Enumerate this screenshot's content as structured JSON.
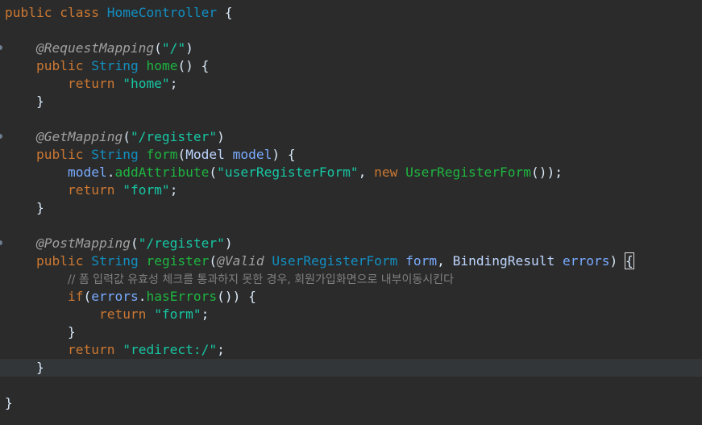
{
  "editor": {
    "language": "java",
    "current_line": 20,
    "lines": [
      [
        [
          "kw",
          "public "
        ],
        [
          "kw",
          "class "
        ],
        [
          "type",
          "HomeController"
        ],
        [
          "pl",
          " {"
        ]
      ],
      [],
      [
        [
          "pl",
          "    "
        ],
        [
          "ann",
          "@RequestMapping"
        ],
        [
          "pl",
          "("
        ],
        [
          "str",
          "\"/\""
        ],
        [
          "pl",
          ")"
        ]
      ],
      [
        [
          "pl",
          "    "
        ],
        [
          "kw",
          "public "
        ],
        [
          "type",
          "String "
        ],
        [
          "fn",
          "home"
        ],
        [
          "pl",
          "() {"
        ]
      ],
      [
        [
          "pl",
          "        "
        ],
        [
          "kw",
          "return "
        ],
        [
          "str",
          "\"home\""
        ],
        [
          "pl",
          ";"
        ]
      ],
      [
        [
          "pl",
          "    }"
        ]
      ],
      [],
      [
        [
          "pl",
          "    "
        ],
        [
          "ann",
          "@GetMapping"
        ],
        [
          "pl",
          "("
        ],
        [
          "str",
          "\"/register\""
        ],
        [
          "pl",
          ")"
        ]
      ],
      [
        [
          "pl",
          "    "
        ],
        [
          "kw",
          "public "
        ],
        [
          "type",
          "String "
        ],
        [
          "fn",
          "form"
        ],
        [
          "pl",
          "("
        ],
        [
          "cls",
          "Model "
        ],
        [
          "var",
          "model"
        ],
        [
          "pl",
          ") {"
        ]
      ],
      [
        [
          "pl",
          "        "
        ],
        [
          "var",
          "model"
        ],
        [
          "pl",
          "."
        ],
        [
          "fn",
          "addAttribute"
        ],
        [
          "pl",
          "("
        ],
        [
          "str",
          "\"userRegisterForm\""
        ],
        [
          "pl",
          ", "
        ],
        [
          "kw",
          "new "
        ],
        [
          "fn",
          "UserRegisterForm"
        ],
        [
          "pl",
          "());"
        ]
      ],
      [
        [
          "pl",
          "        "
        ],
        [
          "kw",
          "return "
        ],
        [
          "str",
          "\"form\""
        ],
        [
          "pl",
          ";"
        ]
      ],
      [
        [
          "pl",
          "    }"
        ]
      ],
      [],
      [
        [
          "pl",
          "    "
        ],
        [
          "ann",
          "@PostMapping"
        ],
        [
          "pl",
          "("
        ],
        [
          "str",
          "\"/register\""
        ],
        [
          "pl",
          ")"
        ]
      ],
      [
        [
          "pl",
          "    "
        ],
        [
          "kw",
          "public "
        ],
        [
          "type",
          "String "
        ],
        [
          "fn",
          "register"
        ],
        [
          "pl",
          "("
        ],
        [
          "ann",
          "@Valid "
        ],
        [
          "type",
          "UserRegisterForm "
        ],
        [
          "var",
          "form"
        ],
        [
          "pl",
          ", "
        ],
        [
          "cls",
          "BindingResult "
        ],
        [
          "var",
          "errors"
        ],
        [
          "pl",
          ") "
        ],
        [
          "brace",
          "{"
        ]
      ],
      [
        [
          "pl",
          "        "
        ],
        [
          "cmt",
          "// 폼 입력값 유효성 체크를 통과하지 못한 경우, 회원가입화면으로 내부이동시킨다"
        ]
      ],
      [
        [
          "pl",
          "        "
        ],
        [
          "kw",
          "if"
        ],
        [
          "pl",
          "("
        ],
        [
          "var",
          "errors"
        ],
        [
          "pl",
          "."
        ],
        [
          "fn",
          "hasErrors"
        ],
        [
          "pl",
          "()) {"
        ]
      ],
      [
        [
          "pl",
          "            "
        ],
        [
          "kw",
          "return "
        ],
        [
          "str",
          "\"form\""
        ],
        [
          "pl",
          ";"
        ]
      ],
      [
        [
          "pl",
          "        }"
        ]
      ],
      [
        [
          "pl",
          "        "
        ],
        [
          "kw",
          "return "
        ],
        [
          "str",
          "\"redirect:/\""
        ],
        [
          "pl",
          ";"
        ]
      ],
      [
        [
          "pl",
          "    }"
        ]
      ],
      [],
      [
        [
          "pl",
          "}"
        ]
      ]
    ],
    "fold_lines": [
      2,
      7,
      13
    ]
  }
}
